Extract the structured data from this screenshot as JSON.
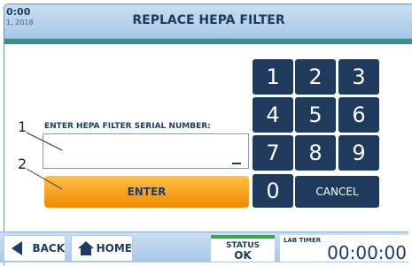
{
  "header": {
    "time": "0:00",
    "date": "1, 2018",
    "title": "REPLACE HEPA FILTER"
  },
  "form": {
    "field_label": "ENTER HEPA FILTER SERIAL NUMBER:",
    "serial_value": "",
    "enter_label": "ENTER"
  },
  "callouts": {
    "one": "1",
    "two": "2"
  },
  "keypad": {
    "keys": [
      "1",
      "2",
      "3",
      "4",
      "5",
      "6",
      "7",
      "8",
      "9",
      "0"
    ],
    "cancel_label": "CANCEL"
  },
  "footer": {
    "back_label": "BACK",
    "home_label": "HOME",
    "status_label": "STATUS",
    "status_value": "OK",
    "timer_label": "LAB TIMER",
    "timer_value": "00:00:00"
  },
  "colors": {
    "accent": "#f5a11a",
    "keypad": "#1f3a5c",
    "status_ok": "#3aa84a",
    "teal": "#3b8f8f"
  }
}
